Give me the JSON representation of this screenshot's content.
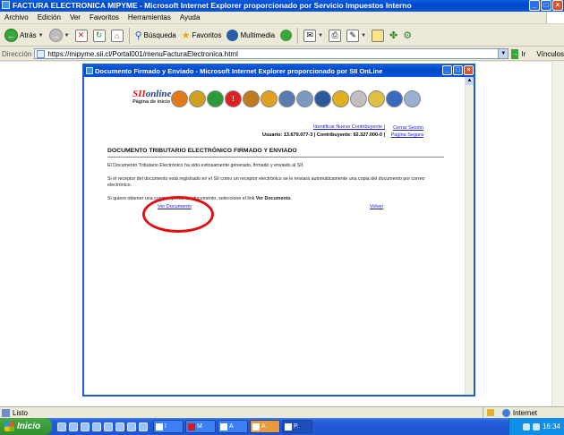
{
  "window": {
    "title": "FACTURA ELECTRONICA MIPYME - Microsoft Internet Explorer proporcionado por Servicio Impuestos Interno"
  },
  "menu": [
    "Archivo",
    "Edición",
    "Ver",
    "Favoritos",
    "Herramientas",
    "Ayuda"
  ],
  "toolbar": {
    "back_label": "Atrás",
    "search_label": "Búsqueda",
    "favorites_label": "Favoritos",
    "media_label": "Multimedia"
  },
  "address": {
    "label": "Dirección",
    "url": "https://mipyme.sii.cl/Portal001/menuFacturaElectronica.html",
    "go_label": "Ir",
    "links_label": "Vínculos"
  },
  "status": {
    "text": "Listo",
    "zone": "Internet"
  },
  "taskbar": {
    "start_label": "Inicio",
    "tasks": [
      "I",
      "M",
      "A",
      "A",
      "P."
    ],
    "clock": "16:34"
  },
  "popup": {
    "title": "Documento Firmado y Enviado - Microsoft Internet Explorer proporcionado por SII OnLine",
    "logo_line1a": "SII",
    "logo_line1b": "online",
    "logo_line2": "Página de inicio",
    "user_line": "Usuario: 13.679.077-3 | Contribuyente: 92.327.000-0 |",
    "change_link": "Identificar Nuevo Contribuyente |",
    "logout_link": "Cerrar Sesión",
    "secure_link": "Página Segura",
    "doc_title": "DOCUMENTO TRIBUTARIO ELECTRÓNICO FIRMADO Y ENVIADO",
    "para1": "El Documento Tributario Electrónico ha sido exitosamente generado, firmado y enviado al SII.",
    "para2": "Si el receptor del documento está registrado en el SII como un receptor electrónico se le enviará automáticamente una copia del documento por correo electrónico.",
    "para3_prefix": "Si quiere obtener una copia impresa del documento, seleccione el link ",
    "para3_link": "Ver Documento",
    "para3_suffix": ".",
    "view_link": "Ver Documento",
    "back_link": "Volver"
  },
  "colors": {
    "xp_blue": "#0246c8",
    "highlight_oval": "#e01010",
    "link": "#2020c0"
  }
}
